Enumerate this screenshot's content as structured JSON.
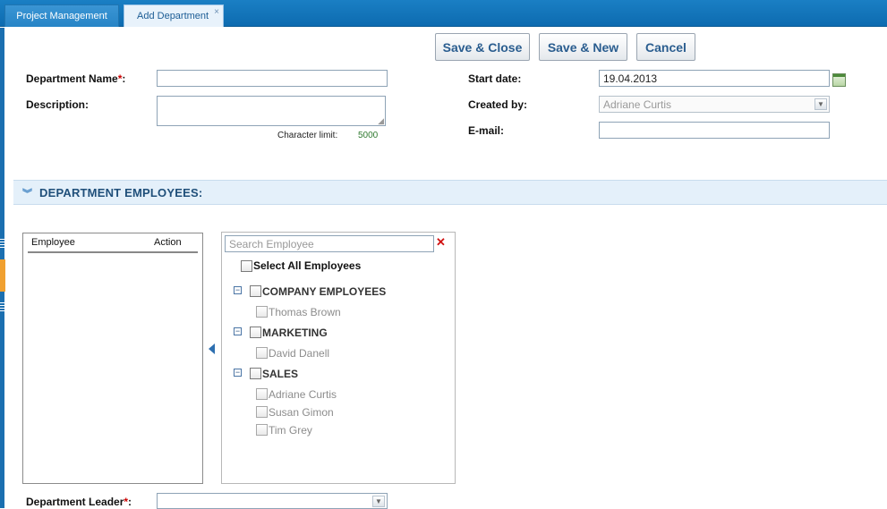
{
  "tabs": [
    {
      "label": "Project Management",
      "active": false
    },
    {
      "label": "Add Department",
      "active": true
    }
  ],
  "tab_close_glyph": "×",
  "toolbar": {
    "save_close": "Save & Close",
    "save_new": "Save & New",
    "cancel": "Cancel"
  },
  "form": {
    "department_name_label": "Department Name",
    "description_label": "Description:",
    "character_limit_label": "Character limit:",
    "character_limit_value": "5000",
    "start_date_label": "Start date:",
    "start_date_value": "19.04.2013",
    "created_by_label": "Created by:",
    "created_by_value": "Adriane Curtis",
    "email_label": "E-mail:",
    "required_marker": "*",
    "colon": ":"
  },
  "section": {
    "title": "DEPARTMENT EMPLOYEES:"
  },
  "employee_table": {
    "columns": [
      "Employee",
      "Action"
    ],
    "rows": []
  },
  "picker": {
    "search_placeholder": "Search Employee",
    "select_all": "Select All Employees",
    "groups": [
      {
        "name": "COMPANY EMPLOYEES",
        "employees": [
          "Thomas Brown"
        ]
      },
      {
        "name": "MARKETING",
        "employees": [
          "David Danell"
        ]
      },
      {
        "name": "SALES",
        "employees": [
          "Adriane Curtis",
          "Susan Gimon",
          "Tim Grey"
        ]
      }
    ]
  },
  "leader": {
    "label": "Department Leader"
  },
  "icons": {
    "collapse": "⊖",
    "dropdown": "▼",
    "chevron": "❯",
    "clear": "✕"
  },
  "colors": {
    "tabbar": "#0d6bb0",
    "accent_text": "#2a5d8f",
    "required": "#cc0000",
    "section_bg": "#e4f0fa"
  }
}
